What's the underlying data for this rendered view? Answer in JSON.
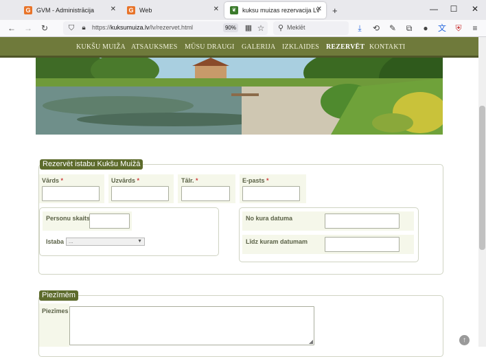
{
  "browser": {
    "tabs": [
      {
        "title": "GVM - Administrācija",
        "favicon": "G"
      },
      {
        "title": "Web",
        "favicon": "G"
      },
      {
        "title": "kuksu muizas rezervacija LV DE",
        "favicon": "K"
      }
    ],
    "new_tab": "+",
    "url_host": "kuksumuiza.lv",
    "url_prefix": "https://",
    "url_path": "/lv/rezervet.html",
    "zoom": "90%",
    "search_placeholder": "Meklēt",
    "colors": {
      "nav_bg": "#6f7a3b",
      "legend_bg": "#5d6b2c"
    }
  },
  "site": {
    "nav": [
      "KUKŠU MUIŽA",
      "ATSAUKSMES",
      "MŪSU DRAUGI",
      "GALERIJA",
      "IZKLAIDES",
      "REZERVĒT",
      "KONTAKTI"
    ],
    "current": "REZERVĒT"
  },
  "form": {
    "legend": "Rezervēt istabu Kukšu Muižā",
    "fields": {
      "vards": "Vārds",
      "uzvards": "Uzvārds",
      "talr": "Tālr.",
      "epasts": "E-pasts"
    },
    "required_mark": "*",
    "persons_label": "Personu skaits",
    "room_label": "Istaba",
    "room_selected": "...",
    "from_label": "No kura datuma",
    "to_label": "Līdz kuram datumam"
  },
  "notes": {
    "legend": "Piezīmēm",
    "label": "Piezīmes"
  }
}
